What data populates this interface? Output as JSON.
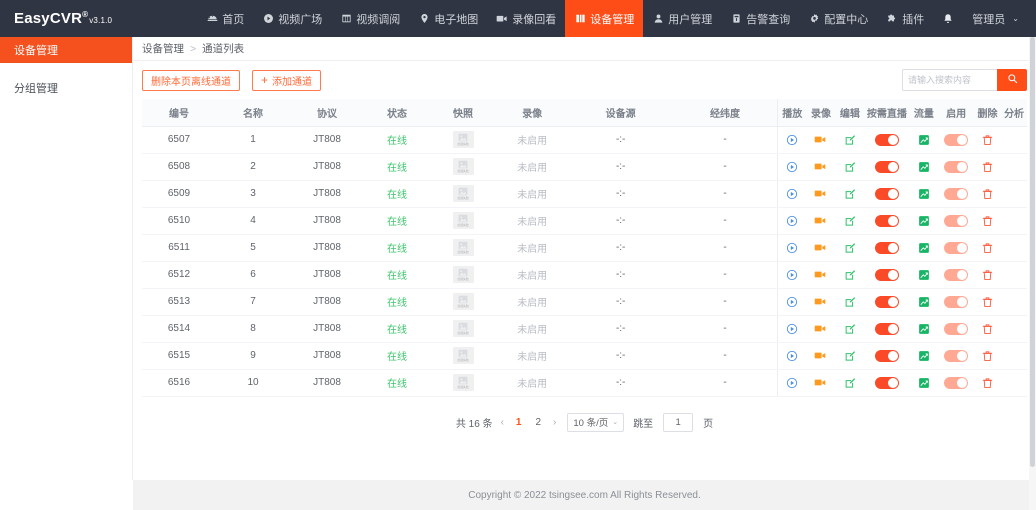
{
  "brand": {
    "name": "EasyCVR",
    "mark": "®",
    "version": "v3.1.0"
  },
  "topnav": {
    "items": [
      {
        "label": "首页",
        "icon": "home-icon",
        "active": false
      },
      {
        "label": "视频广场",
        "icon": "play-circle-icon",
        "active": false
      },
      {
        "label": "视频调阅",
        "icon": "grid-icon",
        "active": false
      },
      {
        "label": "电子地图",
        "icon": "map-pin-icon",
        "active": false
      },
      {
        "label": "录像回看",
        "icon": "video-camera-icon",
        "active": false
      },
      {
        "label": "设备管理",
        "icon": "device-icon",
        "active": true
      },
      {
        "label": "用户管理",
        "icon": "user-icon",
        "active": false
      },
      {
        "label": "告警查询",
        "icon": "alarm-icon",
        "active": false
      },
      {
        "label": "配置中心",
        "icon": "gear-icon",
        "active": false
      },
      {
        "label": "插件",
        "icon": "plugin-icon",
        "active": false
      }
    ],
    "bell": "bell-icon",
    "user": {
      "label": "管理员",
      "caret": "⌄"
    }
  },
  "sidebar": {
    "items": [
      {
        "label": "设备管理",
        "active": true
      },
      {
        "label": "分组管理",
        "active": false
      }
    ]
  },
  "breadcrumb": {
    "parent": "设备管理",
    "sep": ">",
    "current": "通道列表"
  },
  "toolbar": {
    "delete_offline_label": "删除本页离线通道",
    "add_channel_plus": "+",
    "add_channel_label": "添加通道"
  },
  "search": {
    "placeholder": "请输入搜索内容",
    "value": "",
    "icon": "search-icon"
  },
  "table": {
    "columns": [
      "编号",
      "名称",
      "协议",
      "状态",
      "快照",
      "录像",
      "设备源",
      "经纬度"
    ],
    "action_columns": [
      "播放",
      "录像",
      "编辑",
      "按需直播",
      "流量",
      "启用",
      "删除",
      "分析"
    ],
    "snapshot_alt": "加载失败",
    "rows": [
      {
        "id": "6507",
        "name": "1",
        "protocol": "JT808",
        "status": "在线",
        "record": "未启用",
        "source": "-:-",
        "latlng": "-"
      },
      {
        "id": "6508",
        "name": "2",
        "protocol": "JT808",
        "status": "在线",
        "record": "未启用",
        "source": "-:-",
        "latlng": "-"
      },
      {
        "id": "6509",
        "name": "3",
        "protocol": "JT808",
        "status": "在线",
        "record": "未启用",
        "source": "-:-",
        "latlng": "-"
      },
      {
        "id": "6510",
        "name": "4",
        "protocol": "JT808",
        "status": "在线",
        "record": "未启用",
        "source": "-:-",
        "latlng": "-"
      },
      {
        "id": "6511",
        "name": "5",
        "protocol": "JT808",
        "status": "在线",
        "record": "未启用",
        "source": "-:-",
        "latlng": "-"
      },
      {
        "id": "6512",
        "name": "6",
        "protocol": "JT808",
        "status": "在线",
        "record": "未启用",
        "source": "-:-",
        "latlng": "-"
      },
      {
        "id": "6513",
        "name": "7",
        "protocol": "JT808",
        "status": "在线",
        "record": "未启用",
        "source": "-:-",
        "latlng": "-"
      },
      {
        "id": "6514",
        "name": "8",
        "protocol": "JT808",
        "status": "在线",
        "record": "未启用",
        "source": "-:-",
        "latlng": "-"
      },
      {
        "id": "6515",
        "name": "9",
        "protocol": "JT808",
        "status": "在线",
        "record": "未启用",
        "source": "-:-",
        "latlng": "-"
      },
      {
        "id": "6516",
        "name": "10",
        "protocol": "JT808",
        "status": "在线",
        "record": "未启用",
        "source": "-:-",
        "latlng": "-"
      }
    ]
  },
  "pagination": {
    "total_label": "共 16 条",
    "prev": "‹",
    "pages": [
      "1",
      "2"
    ],
    "current_page": "1",
    "next": "›",
    "page_size_label": "10 条/页",
    "page_size_caret": "⌄",
    "jump_prefix": "跳至",
    "jump_value": "1",
    "jump_suffix": "页"
  },
  "footer": {
    "text": "Copyright © 2022 tsingsee.com All Rights Reserved."
  },
  "colors": {
    "brand_orange": "#ff4d18",
    "sidebar_active": "#f4511e",
    "topbar_bg": "#2f3542",
    "online_green": "#3ec46d",
    "toggle_on": "#fb4a27",
    "toggle_soft": "#ffa995"
  }
}
